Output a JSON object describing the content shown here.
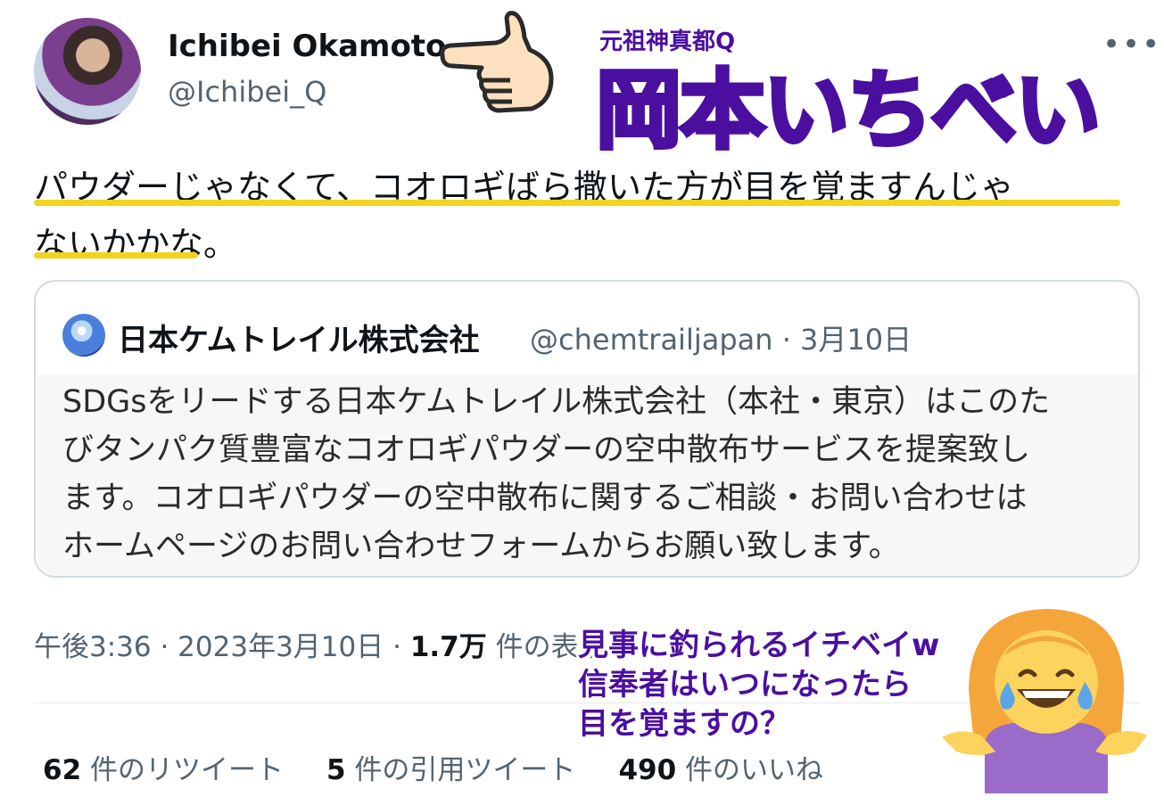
{
  "author": {
    "display_name": "Ichibei Okamoto",
    "handle": "@Ichibei_Q"
  },
  "more_icon": "•••",
  "overlay": {
    "subtitle": "元祖神真都Q",
    "title": "岡本いちべい",
    "color": "#4b0fa0",
    "caption": [
      "見事に釣られるイチベイw",
      "信奉者はいつになったら",
      "目を覚ますの？"
    ]
  },
  "tweet": {
    "text_line1": "パウダーじゃなくて、コオロギばら撒いた方が目を覚ますんじゃ",
    "text_line2": "ないかかな。",
    "highlight_color": "#f3d31b"
  },
  "quote": {
    "name": "日本ケムトレイル株式会社",
    "meta": "@chemtrailjapan · 3月10日",
    "lines": [
      "SDGsをリードする日本ケムトレイル株式会社（本社・東京）はこのた",
      "びタンパク質豊富なコオロギパウダーの空中散布サービスを提案致し",
      "ます。コオロギパウダーの空中散布に関するご相談・お問い合わせは",
      "ホームページのお問い合わせフォームからお願い致します。"
    ]
  },
  "timestamp": {
    "time": "午後3:36 · 2023年3月10日 · ",
    "views_count": "1.7万",
    "views_label": " 件の表示"
  },
  "stats": {
    "retweets_count": "62",
    "retweets_label": " 件のリツイート",
    "quotes_count": "5",
    "quotes_label": " 件の引用ツイート",
    "likes_count": "490",
    "likes_label": " 件のいいね"
  }
}
